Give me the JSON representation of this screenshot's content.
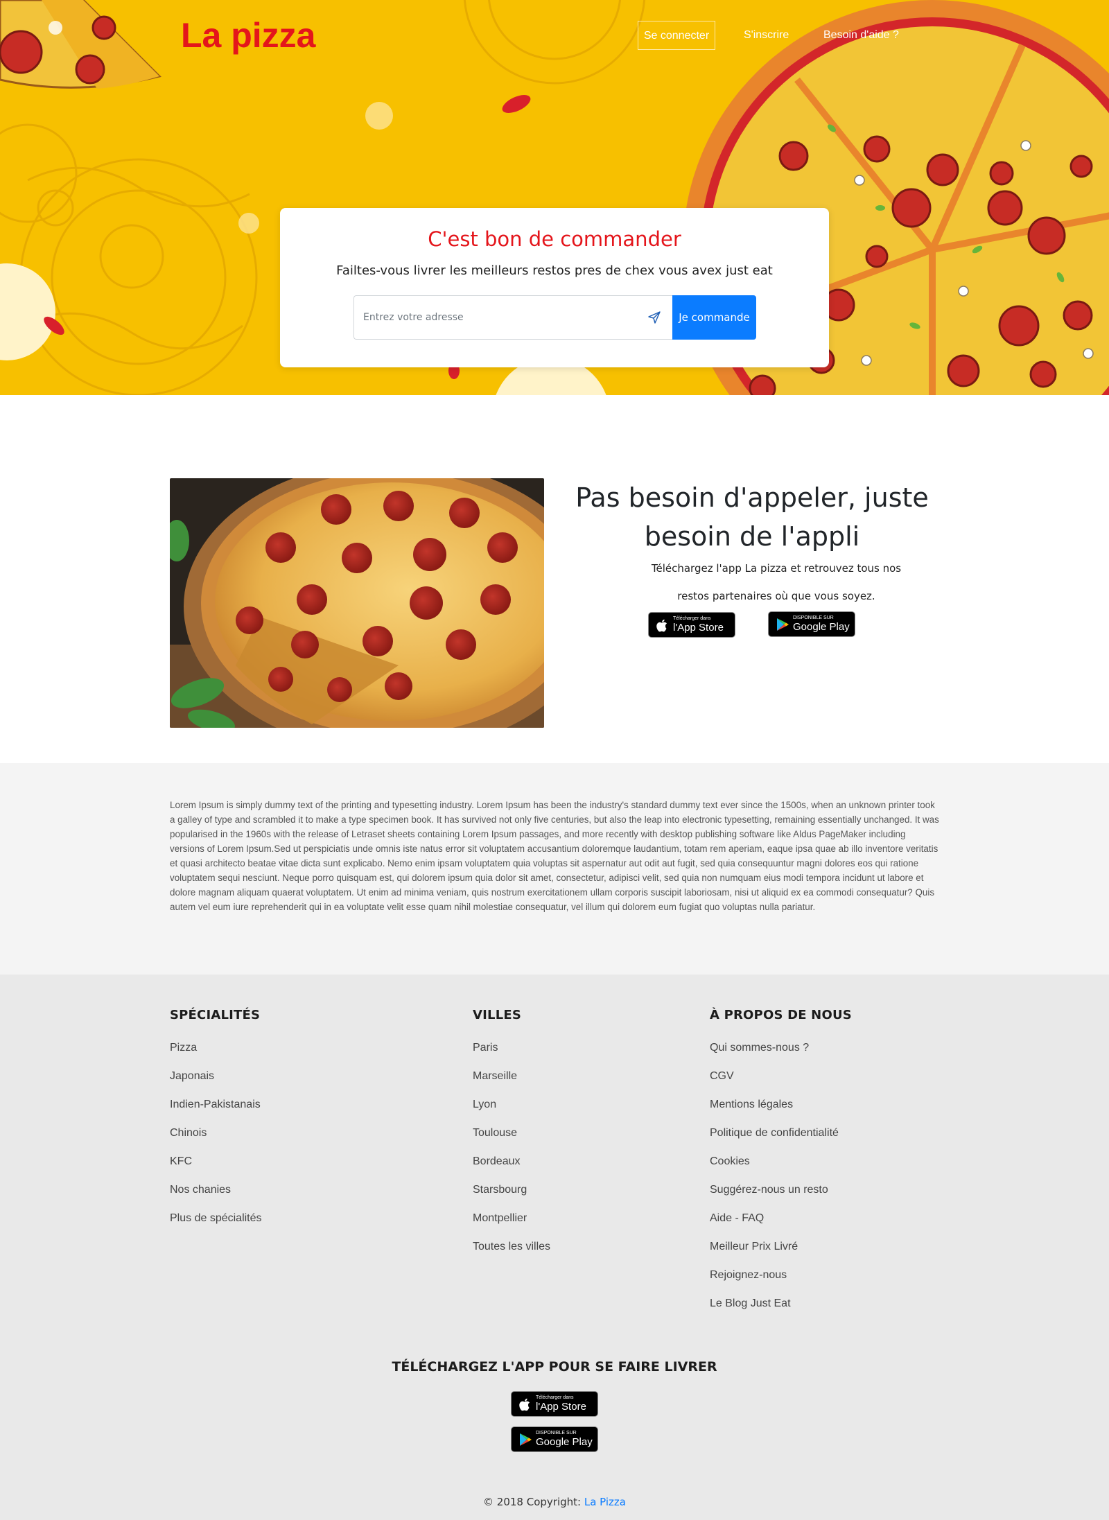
{
  "header": {
    "brand": "La pizza",
    "nav": {
      "login": "Se connecter",
      "signup": "S'inscrire",
      "help": "Besoin d'aide ?"
    }
  },
  "hero": {
    "title": "C'est bon de commander",
    "subtitle": "Failtes-vous livrer les meilleurs restos pres de chex vous avex just eat",
    "address_placeholder": "Entrez votre adresse",
    "address_value": "",
    "submit_label": "Je commande"
  },
  "app": {
    "title": "Pas besoin d'appeler, juste besoin de l'appli",
    "text": "Téléchargez l'app La pizza et retrouvez tous nos restos partenaires où que vous soyez."
  },
  "badges": {
    "apple_small": "Télécharger dans",
    "apple_big": "l'App Store",
    "google_small": "DISPONIBLE SUR",
    "google_big": "Google Play"
  },
  "lorem": "Lorem Ipsum is simply dummy text of the printing and typesetting industry. Lorem Ipsum has been the industry's standard dummy text ever since the 1500s, when an unknown printer took a galley of type and scrambled it to make a type specimen book. It has survived not only five centuries, but also the leap into electronic typesetting, remaining essentially unchanged. It was popularised in the 1960s with the release of Letraset sheets containing Lorem Ipsum passages, and more recently with desktop publishing software like Aldus PageMaker including versions of Lorem Ipsum.Sed ut perspiciatis unde omnis iste natus error sit voluptatem accusantium doloremque laudantium, totam rem aperiam, eaque ipsa quae ab illo inventore veritatis et quasi architecto beatae vitae dicta sunt explicabo. Nemo enim ipsam voluptatem quia voluptas sit aspernatur aut odit aut fugit, sed quia consequuntur magni dolores eos qui ratione voluptatem sequi nesciunt. Neque porro quisquam est, qui dolorem ipsum quia dolor sit amet, consectetur, adipisci velit, sed quia non numquam eius modi tempora incidunt ut labore et dolore magnam aliquam quaerat voluptatem. Ut enim ad minima veniam, quis nostrum exercitationem ullam corporis suscipit laboriosam, nisi ut aliquid ex ea commodi consequatur? Quis autem vel eum iure reprehenderit qui in ea voluptate velit esse quam nihil molestiae consequatur, vel illum qui dolorem eum fugiat quo voluptas nulla pariatur.",
  "footer": {
    "specialties": {
      "title": "SPÉCIALITÉS",
      "items": [
        "Pizza",
        "Japonais",
        "Indien-Pakistanais",
        "Chinois",
        "KFC",
        "Nos chanies",
        "Plus de spécialités"
      ]
    },
    "cities": {
      "title": "VILLES",
      "items": [
        "Paris",
        "Marseille",
        "Lyon",
        "Toulouse",
        "Bordeaux",
        "Starsbourg",
        "Montpellier",
        "Toutes les villes"
      ]
    },
    "about": {
      "title": "À PROPOS DE NOUS",
      "items": [
        "Qui sommes-nous ?",
        "CGV",
        "Mentions légales",
        "Politique de confidentialité",
        "Cookies",
        "Suggérez-nous un resto",
        "Aide - FAQ",
        "Meilleur Prix Livré",
        "Rejoignez-nous",
        "Le Blog Just Eat"
      ]
    },
    "download_title": "TÉLÉCHARGEZ L'APP POUR SE FAIRE LIVRER",
    "copyright_prefix": "© 2018 Copyright: ",
    "copyright_link": "La Pizza"
  },
  "colors": {
    "hero_bg": "#f7c000",
    "brand_red": "#e4151b",
    "primary_blue": "#0b7cff",
    "lorem_bg": "#f4f4f4",
    "footer_bg": "#e9e9e9"
  },
  "icons": {
    "send": "send-icon",
    "apple": "apple-icon",
    "google_play": "google-play-icon"
  }
}
